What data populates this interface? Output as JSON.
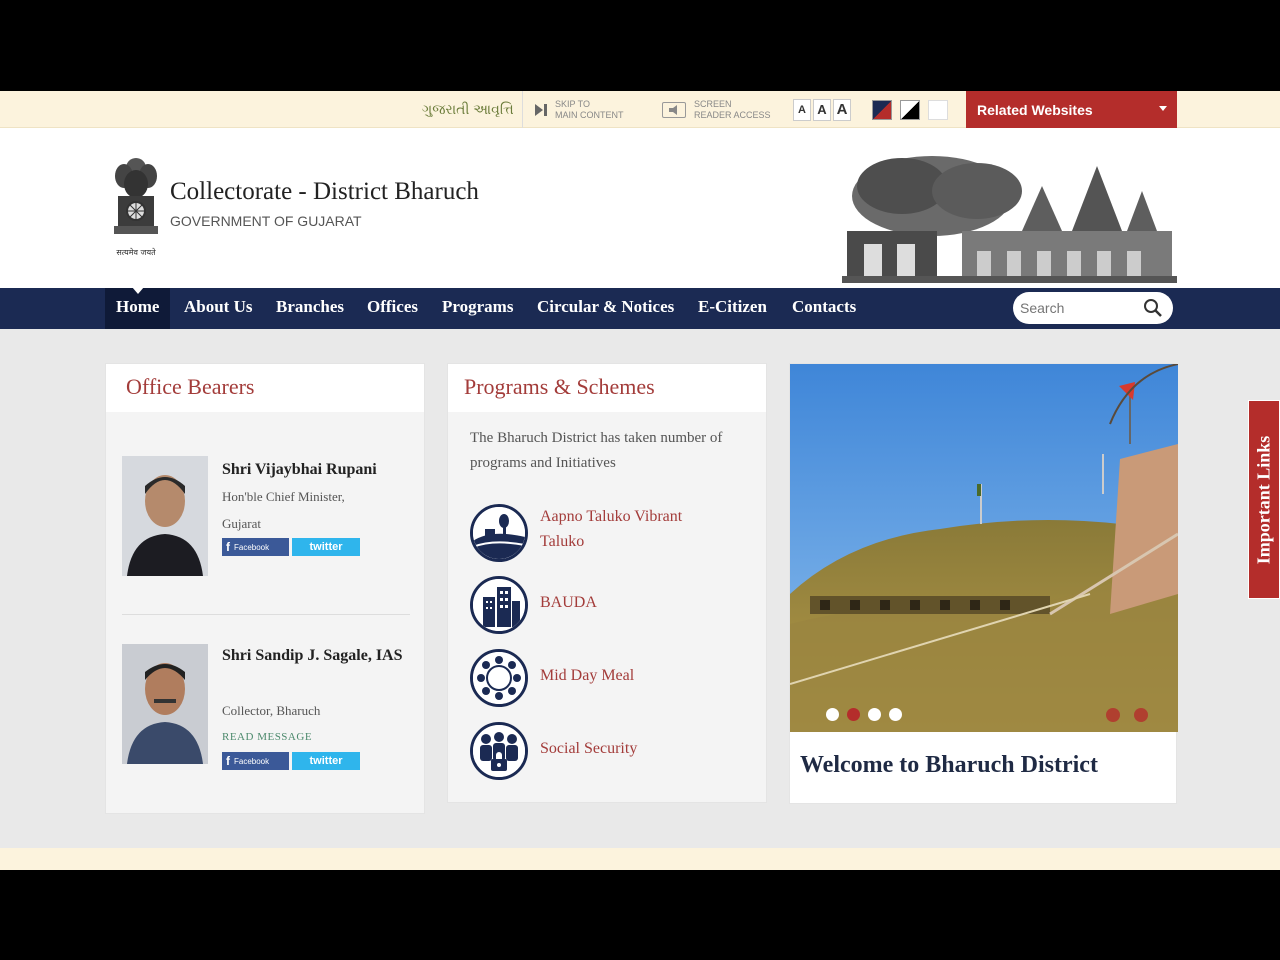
{
  "topbar": {
    "language": "ગુજરાતી આવૃત્તિ",
    "skip_line1": "SKIP TO",
    "skip_line2": "MAIN CONTENT",
    "screen_line1": "SCREEN",
    "screen_line2": "READER ACCESS",
    "font_sizes": [
      "A",
      "A",
      "A"
    ],
    "related_label": "Related Websites"
  },
  "header": {
    "title": "Collectorate - District Bharuch",
    "subtitle": "GOVERNMENT OF GUJARAT",
    "emblem_caption": "सत्यमेव जयते"
  },
  "nav": {
    "items": [
      "Home",
      "About Us",
      "Branches",
      "Offices",
      "Programs",
      "Circular & Notices",
      "E-Citizen",
      "Contacts"
    ],
    "search_placeholder": "Search"
  },
  "office_bearers": {
    "title": "Office Bearers",
    "people": [
      {
        "name": "Shri Vijaybhai Rupani",
        "role": "Hon'ble Chief Minister, Gujarat",
        "read": ""
      },
      {
        "name": "Shri Sandip J. Sagale, IAS",
        "role": "Collector, Bharuch",
        "read": "READ MESSAGE"
      }
    ],
    "facebook": "Facebook",
    "twitter": "twitter"
  },
  "programs": {
    "title": "Programs & Schemes",
    "description": "The Bharuch District has taken number of programs and Initiatives",
    "items": [
      {
        "label": "Aapno Taluko Vibrant Taluko",
        "icon": "landscape-icon"
      },
      {
        "label": "BAUDA",
        "icon": "buildings-icon"
      },
      {
        "label": "Mid Day Meal",
        "icon": "meal-circle-icon"
      },
      {
        "label": "Social Security",
        "icon": "people-lock-icon"
      }
    ]
  },
  "slider": {
    "caption": "Welcome to Bharuch District",
    "active_dot": 2,
    "dot_count": 4
  },
  "important_links": "Important Links",
  "colors": {
    "nav_bg": "#1b2a53",
    "accent_red": "#b42d2b",
    "topbar_bg": "#fcf3dd"
  }
}
